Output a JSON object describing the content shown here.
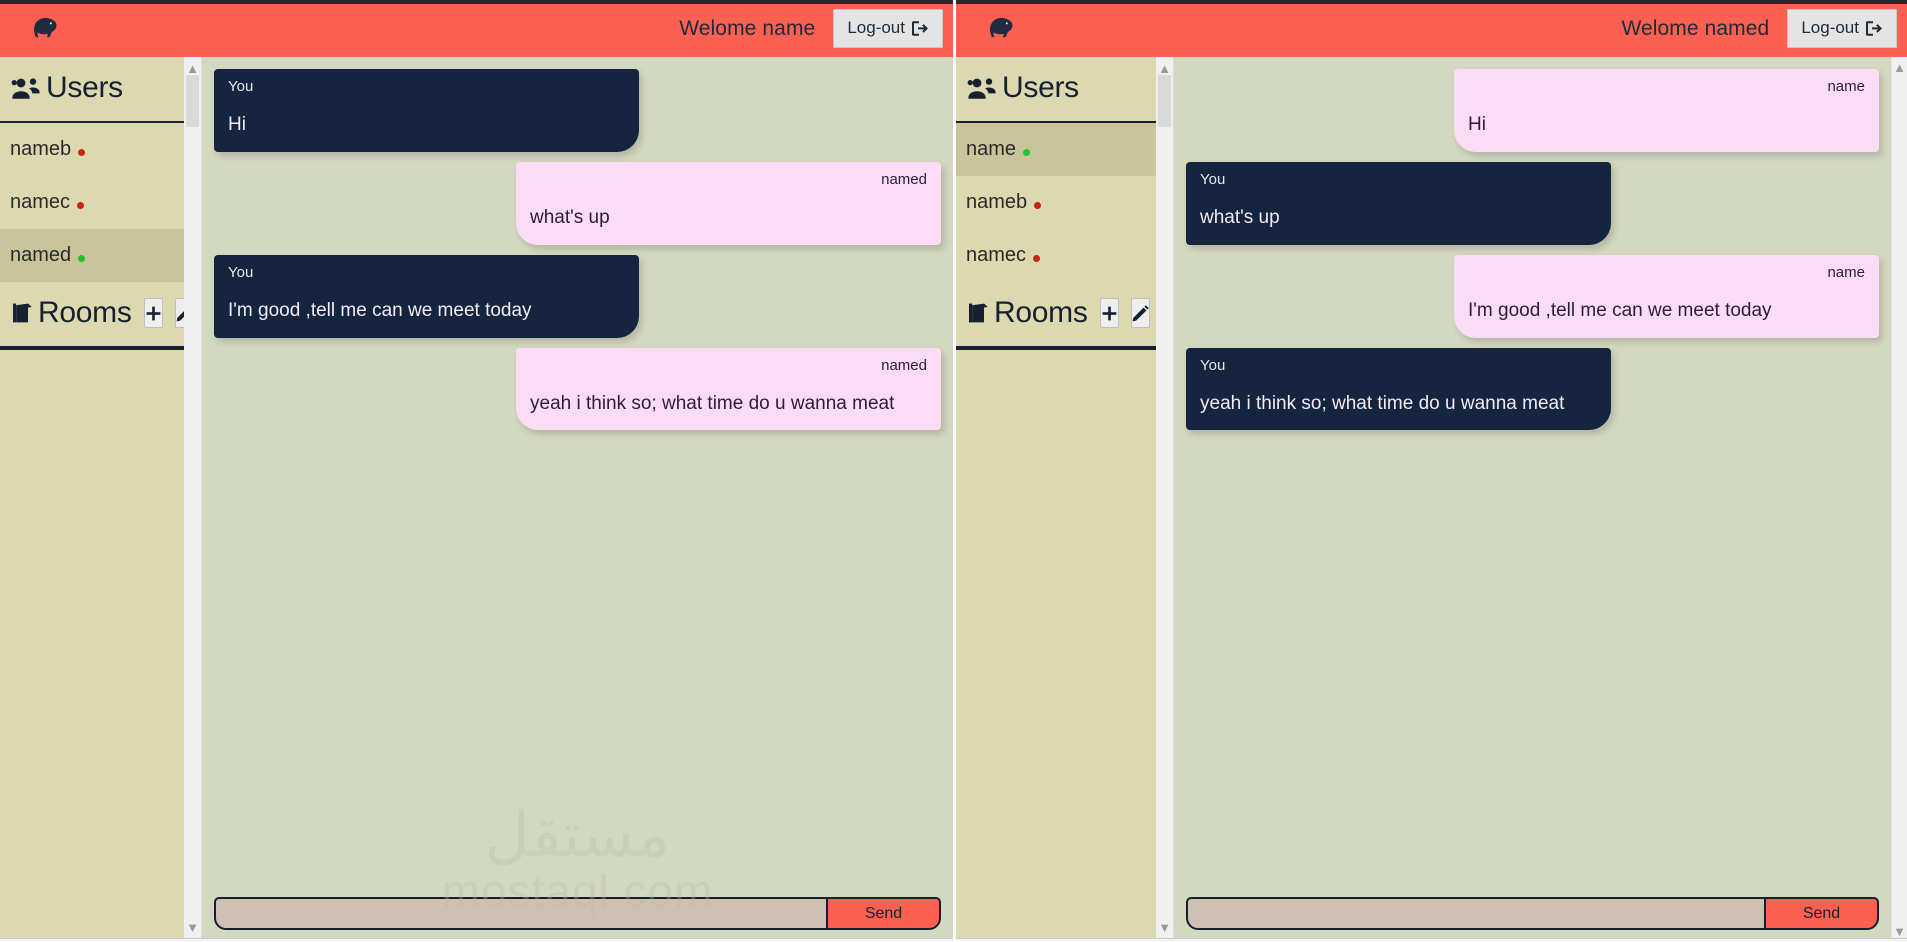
{
  "windows": [
    {
      "id": "left",
      "navbar": {
        "logo_icon": "kiwi-bird-icon",
        "welcome_text": "Welome name",
        "logout_label": "Log-out",
        "logout_icon": "sign-out-icon",
        "accent_color": "#fb6051"
      },
      "sidebar": {
        "users_header": {
          "icon": "users-icon",
          "title": "Users"
        },
        "users": [
          {
            "name": "nameb",
            "status": "offline",
            "active": false
          },
          {
            "name": "namec",
            "status": "offline",
            "active": false
          },
          {
            "name": "named",
            "status": "online",
            "active": true
          }
        ],
        "rooms_header": {
          "icon": "door-icon",
          "title": "Rooms",
          "add_label": "+",
          "add_icon": "plus-icon",
          "edit_icon": "pencil-icon"
        }
      },
      "chat": {
        "messages": [
          {
            "sender": "You",
            "text": "Hi",
            "direction": "out"
          },
          {
            "sender": "named",
            "text": "what's up",
            "direction": "in"
          },
          {
            "sender": "You",
            "text": "I'm good ,tell me can we meet today",
            "direction": "out"
          },
          {
            "sender": "named",
            "text": "yeah i think so; what time do u wanna meat",
            "direction": "in"
          }
        ],
        "composer": {
          "input_value": "",
          "input_placeholder": "",
          "send_label": "Send"
        }
      }
    },
    {
      "id": "right",
      "navbar": {
        "logo_icon": "kiwi-bird-icon",
        "welcome_text": "Welome named",
        "logout_label": "Log-out",
        "logout_icon": "sign-out-icon",
        "accent_color": "#fb6051"
      },
      "sidebar": {
        "users_header": {
          "icon": "users-icon",
          "title": "Users"
        },
        "users": [
          {
            "name": "name",
            "status": "online",
            "active": true
          },
          {
            "name": "nameb",
            "status": "offline",
            "active": false
          },
          {
            "name": "namec",
            "status": "offline",
            "active": false
          }
        ],
        "rooms_header": {
          "icon": "door-icon",
          "title": "Rooms",
          "add_label": "+",
          "add_icon": "plus-icon",
          "edit_icon": "pencil-icon"
        }
      },
      "chat": {
        "messages": [
          {
            "sender": "name",
            "text": "Hi",
            "direction": "in"
          },
          {
            "sender": "You",
            "text": "what's up",
            "direction": "out"
          },
          {
            "sender": "name",
            "text": "I'm good ,tell me can we meet today",
            "direction": "in"
          },
          {
            "sender": "You",
            "text": "yeah i think so; what time do u wanna meat",
            "direction": "out"
          }
        ],
        "composer": {
          "input_value": "",
          "input_placeholder": "",
          "send_label": "Send"
        }
      }
    }
  ],
  "watermark": {
    "arabic": "مستقل",
    "latin": "mostaql.com"
  },
  "colors": {
    "accent": "#fb6051",
    "sidebar_bg": "#dcd8b0",
    "sidebar_active": "#c9c49b",
    "chat_bg": "#d3d8c0",
    "bubble_out": "#15253f",
    "bubble_in": "#fcdcf5",
    "online": "#1fc52b",
    "offline": "#c9231a"
  }
}
